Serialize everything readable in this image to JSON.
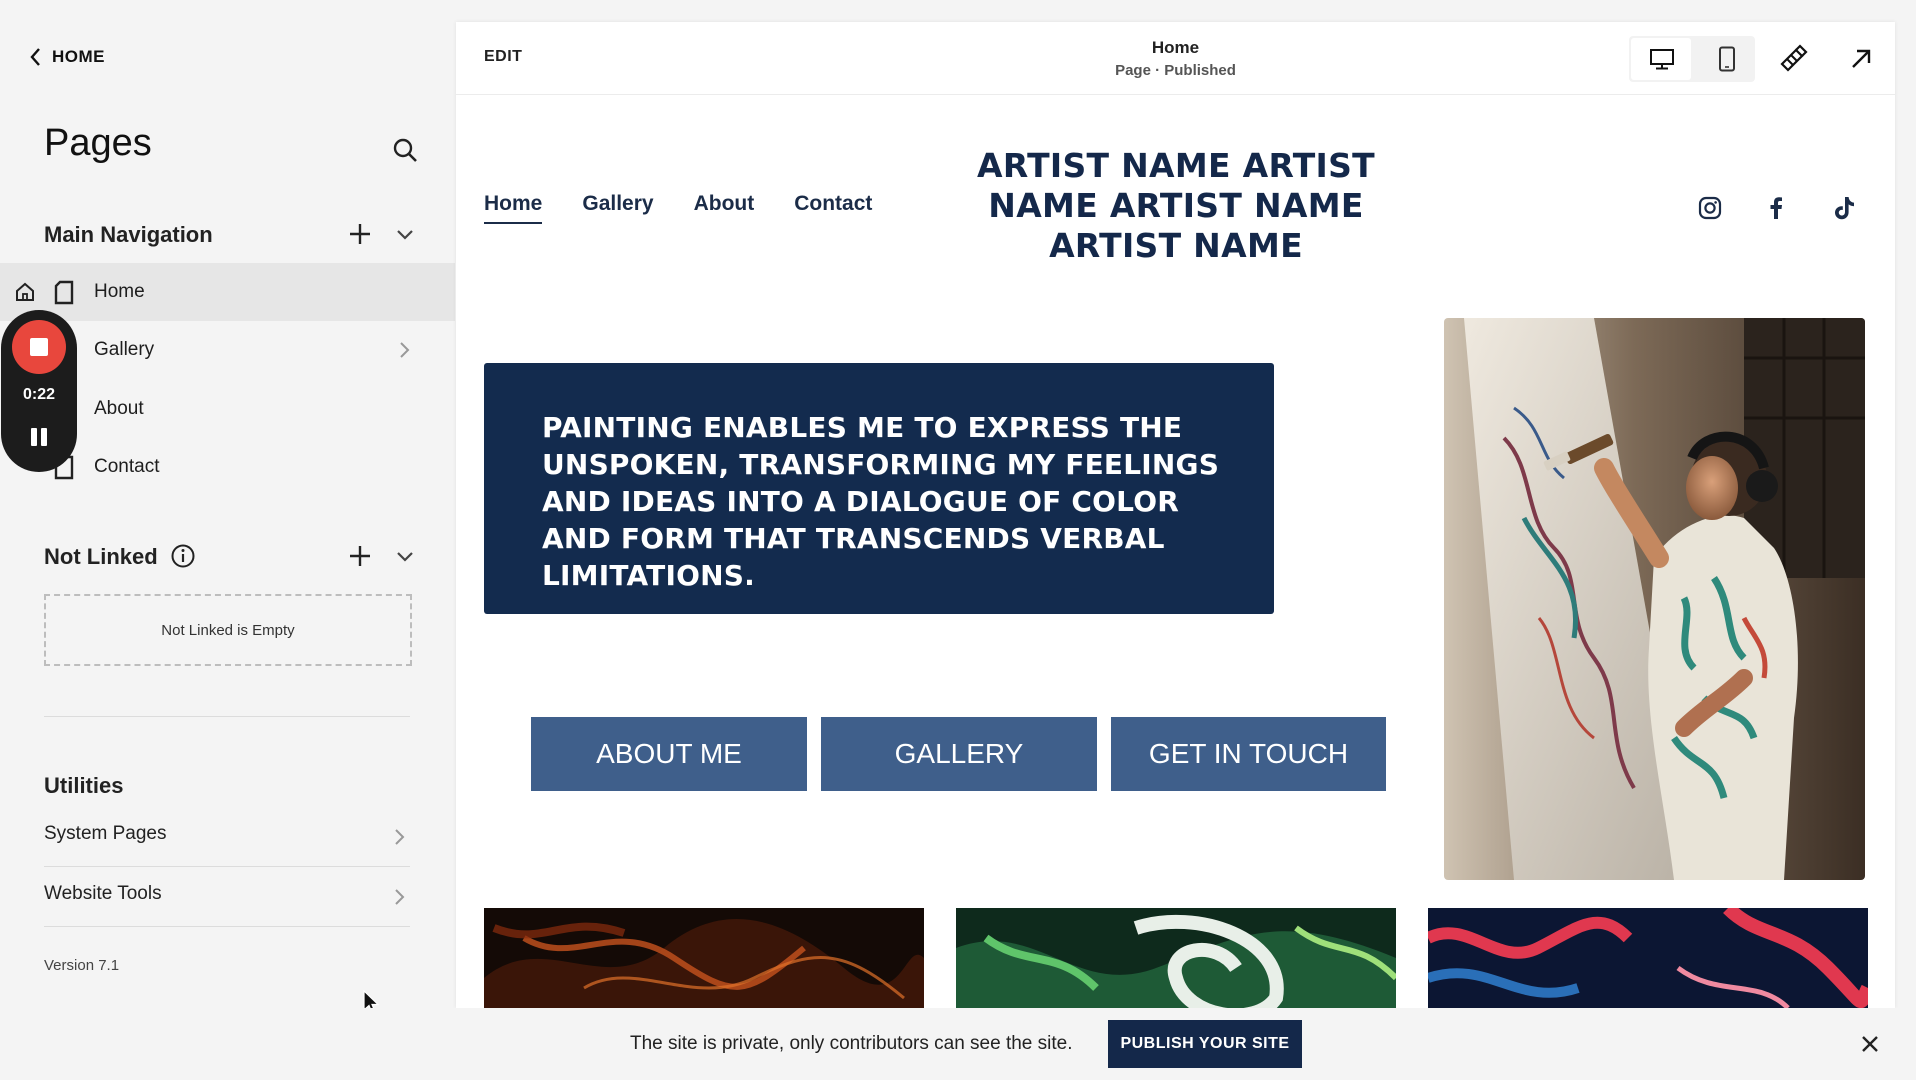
{
  "sidebar": {
    "back_label": "HOME",
    "title": "Pages",
    "main_nav": {
      "heading": "Main Navigation",
      "items": [
        {
          "label": "Home"
        },
        {
          "label": "Gallery"
        },
        {
          "label": "About"
        },
        {
          "label": "Contact"
        }
      ]
    },
    "recorder": {
      "time": "0:22",
      "stop_color": "#e8473d"
    },
    "not_linked": {
      "heading": "Not Linked",
      "empty_text": "Not Linked is Empty"
    },
    "utilities": {
      "heading": "Utilities",
      "items": [
        {
          "label": "System Pages"
        },
        {
          "label": "Website Tools"
        }
      ]
    },
    "version": "Version 7.1"
  },
  "preview": {
    "edit_label": "EDIT",
    "page_title": "Home",
    "page_status": "Page · Published",
    "site": {
      "nav": [
        "Home",
        "Gallery",
        "About",
        "Contact"
      ],
      "title": "ARTIST NAME ARTIST NAME ARTIST NAME ARTIST NAME",
      "social_icons": [
        "instagram-icon",
        "facebook-icon",
        "tiktok-icon"
      ],
      "quote": "PAINTING ENABLES ME TO EXPRESS THE UNSPOKEN, TRANSFORMING MY FEELINGS AND IDEAS INTO A DIALOGUE OF COLOR AND FORM THAT TRANSCENDS VERBAL LIMITATIONS.",
      "buttons": [
        "ABOUT ME",
        "GALLERY",
        "GET IN TOUCH"
      ],
      "colors": {
        "navy": "#132b4e",
        "button": "#3f5f8b"
      }
    }
  },
  "banner": {
    "text": "The site is private, only contributors can see the site.",
    "publish_label": "PUBLISH YOUR SITE"
  }
}
